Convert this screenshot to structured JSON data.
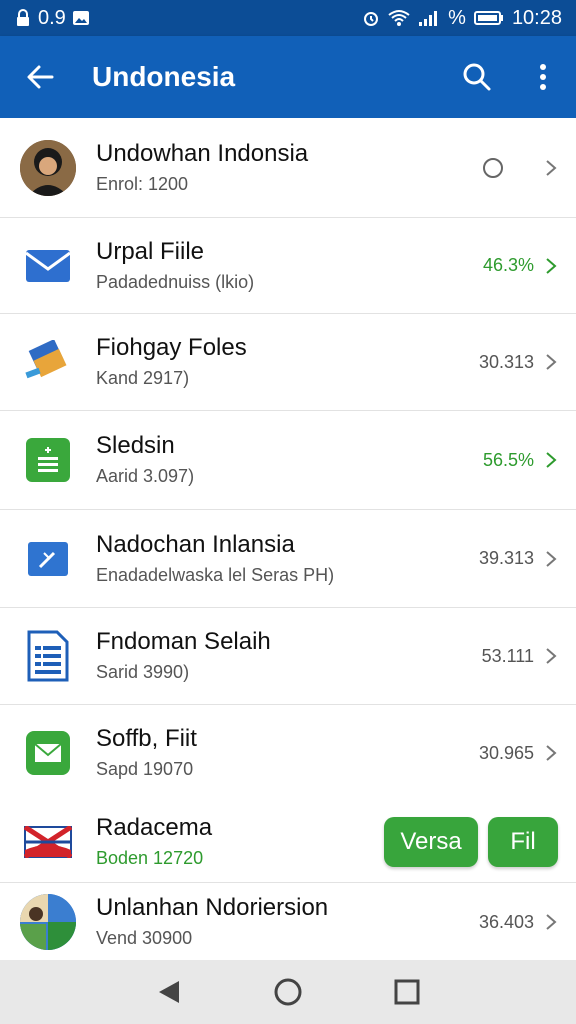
{
  "status": {
    "left_text": "0.9",
    "battery_text": "%",
    "time": "10:28"
  },
  "app_bar": {
    "title": "Undonesia",
    "back_icon": "arrow-back-icon",
    "search_icon": "search-icon",
    "menu_icon": "more-vert-icon"
  },
  "colors": {
    "status_bar": "#0c4d96",
    "app_bar": "#1160b8",
    "accent_green": "#38a53c",
    "text_green": "#2e9b2e"
  },
  "list": [
    {
      "primary": "Undowhan Indonsia",
      "secondary": "Enrol: 1200",
      "value": "",
      "icon": "avatar"
    },
    {
      "primary": "Urpal Fiile",
      "secondary": "Padadednuiss (lkio)",
      "value": "46.3%",
      "icon": "mail-icon"
    },
    {
      "primary": "Fiohgay Foles",
      "secondary": "Kand 2917)",
      "value": "30.313",
      "icon": "book-icon"
    },
    {
      "primary": "Sledsin",
      "secondary": "Aarid 3.097)",
      "value": "56.5%",
      "icon": "sheet-icon"
    },
    {
      "primary": "Nadochan Inlansia",
      "secondary": "Enadadelwaska lel Seras PH)",
      "value": "39.313",
      "icon": "edit-doc-icon"
    },
    {
      "primary": "Fndoman Selaih",
      "secondary": "Sarid 3990)",
      "value": "53.111",
      "icon": "document-icon"
    },
    {
      "primary": "Soffb, Fiit",
      "secondary": "Sapd 19070",
      "value": "30.965",
      "icon": "envelope-app-icon"
    },
    {
      "primary": "Radacema",
      "secondary": "Boden 12720",
      "value": "",
      "icon": "flag-icon",
      "buttons": [
        "Versa",
        "Fil"
      ]
    },
    {
      "primary": "Unlanhan Ndoriersion",
      "secondary": "Vend 30900",
      "value": "36.403",
      "icon": "photo-avatar"
    }
  ],
  "nav": {
    "back": "nav-back-icon",
    "home": "nav-home-icon",
    "recents": "nav-recents-icon"
  }
}
